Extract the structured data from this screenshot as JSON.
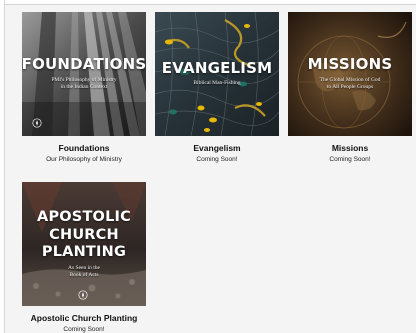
{
  "cards": [
    {
      "image_heading": "FOUNDATIONS",
      "image_subtitle_1": "PMI's Philosophy of Ministry",
      "image_subtitle_2": "in the Indian Context",
      "title": "Foundations",
      "caption": "Our Philosophy of Ministry"
    },
    {
      "image_heading": "EVANGELISM",
      "image_subtitle_1": "Biblical Man-Fishing",
      "title": "Evangelism",
      "caption": "Coming Soon!"
    },
    {
      "image_heading": "MISSIONS",
      "image_subtitle_1": "The Global Mission of God",
      "image_subtitle_2": "to All People Groups",
      "title": "Missions",
      "caption": "Coming Soon!"
    },
    {
      "image_heading_1": "APOSTOLIC",
      "image_heading_2": "CHURCH",
      "image_heading_3": "PLANTING",
      "image_subtitle_1": "As Seen in the",
      "image_subtitle_2": "Book of Acts",
      "title": "Apostolic Church Planting",
      "caption": "Coming Soon!"
    }
  ],
  "icons": {
    "emblem": "ministry-emblem-icon"
  }
}
